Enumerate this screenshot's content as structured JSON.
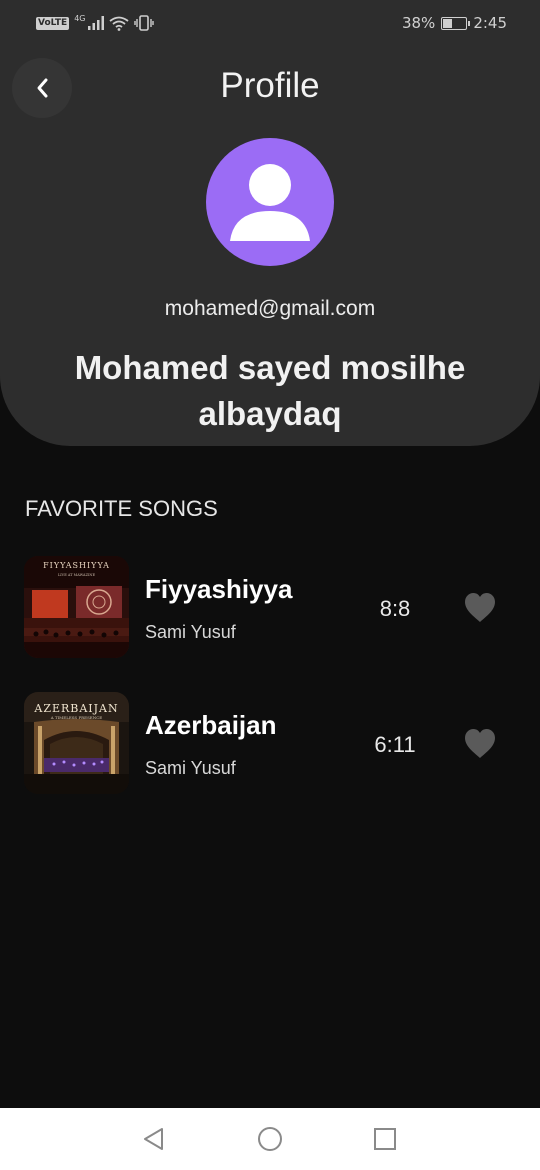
{
  "status_bar": {
    "volte": "VoLTE",
    "network": "4G",
    "battery": "38%",
    "time": "2:45"
  },
  "header": {
    "title": "Profile",
    "back_icon": "chevron-left-icon"
  },
  "profile": {
    "avatar_icon": "user-icon",
    "avatar_color": "#9b6cf5",
    "email": "mohamed@gmail.com",
    "name": "Mohamed sayed mosilhe albaydaq"
  },
  "favorites": {
    "title": "FAVORITE SONGS",
    "songs": [
      {
        "title": "Fiyyashiyya",
        "artist": "Sami Yusuf",
        "duration": "8:8",
        "cover_text": "FIYYASHIYYA",
        "cover_subtext": "LIVE AT MAWAZINE"
      },
      {
        "title": "Azerbaijan",
        "artist": "Sami Yusuf",
        "duration": "6:11",
        "cover_text": "AZERBAIJAN",
        "cover_subtext": "A TIMELESS PRESENCE"
      }
    ]
  },
  "nav": {
    "back_icon": "triangle-back-icon",
    "home_icon": "circle-home-icon",
    "recents_icon": "square-recents-icon"
  }
}
